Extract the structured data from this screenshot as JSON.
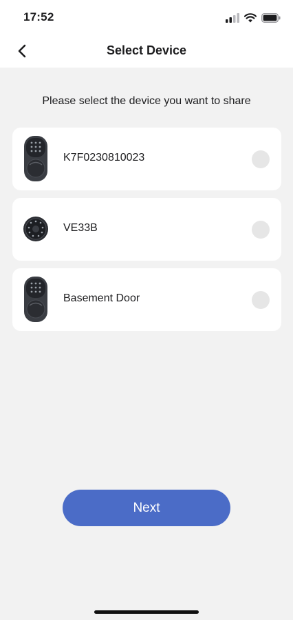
{
  "status_bar": {
    "time": "17:52"
  },
  "nav": {
    "title": "Select Device"
  },
  "prompt": "Please select the device you want to share",
  "devices": [
    {
      "name": "K7F0230810023",
      "icon": "door-lock-keypad-icon",
      "selected": false
    },
    {
      "name": "VE33B",
      "icon": "deadbolt-keypad-icon",
      "selected": false
    },
    {
      "name": "Basement Door",
      "icon": "door-lock-keypad-icon",
      "selected": false
    }
  ],
  "next_button": {
    "label": "Next"
  },
  "colors": {
    "accent": "#4b6cc7",
    "background": "#f2f2f2",
    "card": "#ffffff",
    "radio": "#e6e6e6"
  }
}
